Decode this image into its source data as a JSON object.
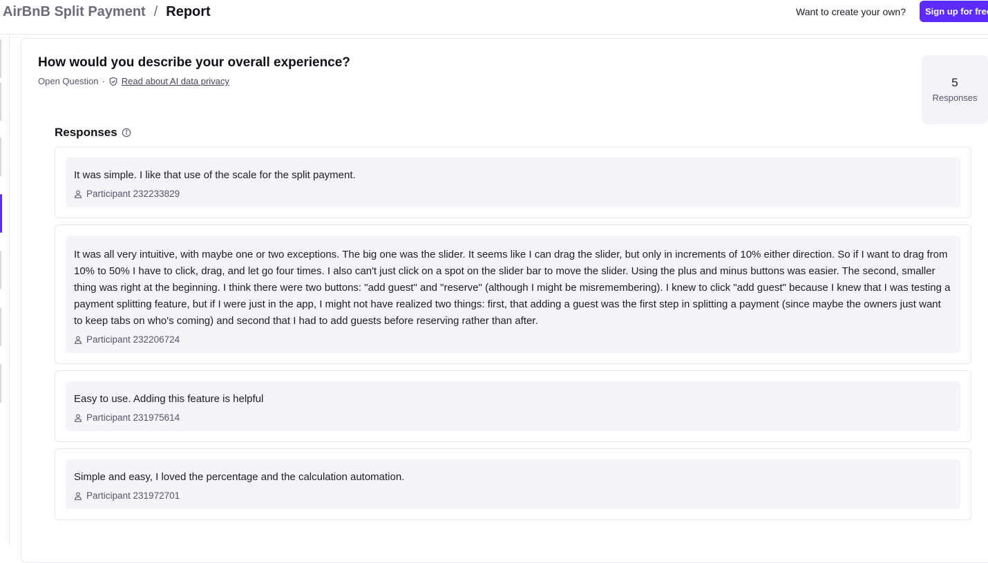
{
  "header": {
    "project": "AirBnB Split Payment",
    "separator": "/",
    "page": "Report",
    "cta_text": "Want to create your own?",
    "signup_label": "Sign up for free"
  },
  "question": {
    "title": "How would you describe your overall experience?",
    "type": "Open Question",
    "privacy_link": "Read about AI data privacy"
  },
  "stats": {
    "count": "5",
    "label": "Responses"
  },
  "responses_section": {
    "title": "Responses",
    "items": [
      {
        "text": "It was simple. I like that use of the scale for the split payment.",
        "participant": "Participant 232233829"
      },
      {
        "text": "It was all very intuitive, with maybe one or two exceptions. The big one was the slider. It seems like I can drag the slider, but only in increments of 10% either direction. So if I want to drag from 10% to 50% I have to click, drag, and let go four times. I also can't just click on a spot on the slider bar to move the slider. Using the plus and minus buttons was easier. The second, smaller thing was right at the beginning. I think there were two buttons: \"add guest\" and \"reserve\" (although I might be misremembering). I knew to click \"add guest\" because I knew that I was testing a payment splitting feature, but if I were just in the app, I might not have realized two things: first, that adding a guest was the first step in splitting a payment (since maybe the owners just want to keep tabs on who's coming) and second that I had to add guests before reserving rather than after.",
        "participant": "Participant 232206724"
      },
      {
        "text": "Easy to use. Adding this feature is helpful",
        "participant": "Participant 231975614"
      },
      {
        "text": "Simple and easy, I loved the percentage and the calculation automation.",
        "participant": "Participant 231972701"
      }
    ]
  },
  "colors": {
    "accent": "#5b2bff",
    "response_bg": "#f4f4f9",
    "border": "#e6e6ee"
  }
}
